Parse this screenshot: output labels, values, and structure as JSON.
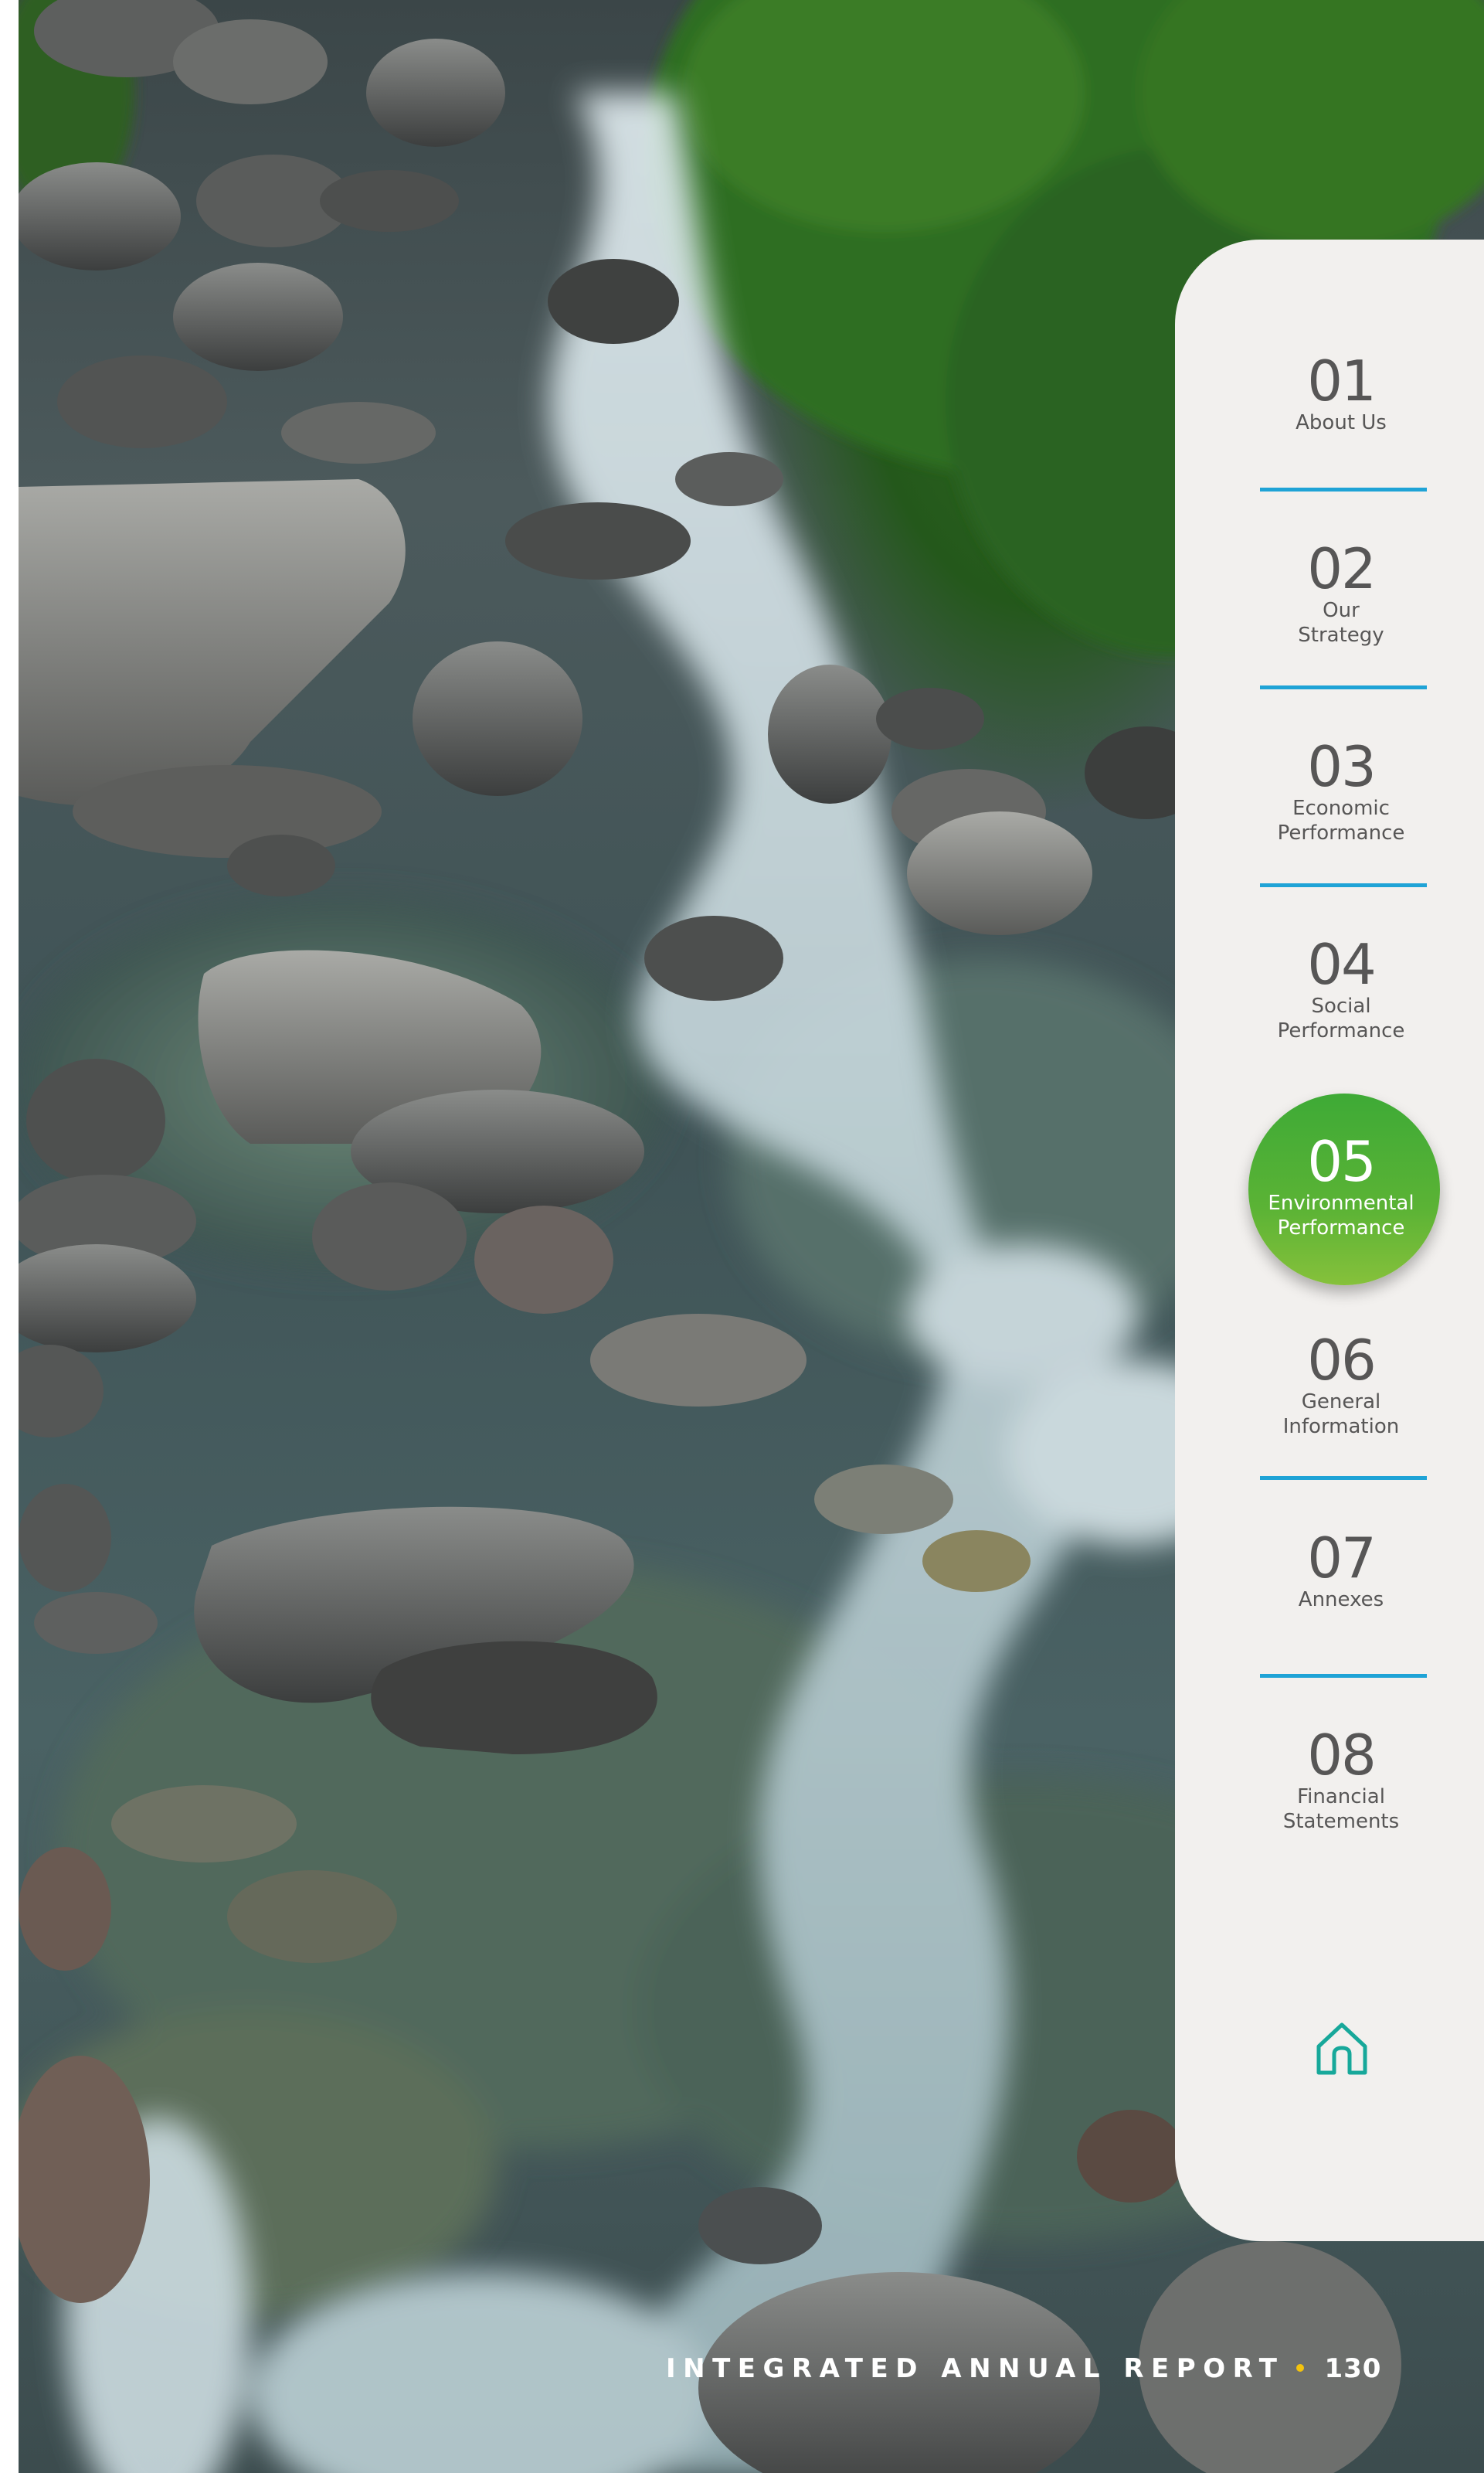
{
  "nav": {
    "items": [
      {
        "number": "01",
        "label": "About Us"
      },
      {
        "number": "02",
        "label": "Our\nStrategy"
      },
      {
        "number": "03",
        "label": "Economic\nPerformance"
      },
      {
        "number": "04",
        "label": "Social\nPerformance"
      },
      {
        "number": "05",
        "label": "Environmental\nPerformance",
        "active": true
      },
      {
        "number": "06",
        "label": "General\nInformation"
      },
      {
        "number": "07",
        "label": "Annexes"
      },
      {
        "number": "08",
        "label": "Financial\nStatements"
      }
    ],
    "home_icon": "home-icon"
  },
  "footer": {
    "title": "INTEGRATED ANNUAL REPORT",
    "page_number": "130"
  },
  "colors": {
    "panel_bg": "#f2f0ee",
    "divider": "#1fa3d6",
    "active_green": "#4fae35",
    "nav_text": "#575656",
    "footer_dot": "#f4c30d",
    "home_icon": "#17a89a"
  }
}
